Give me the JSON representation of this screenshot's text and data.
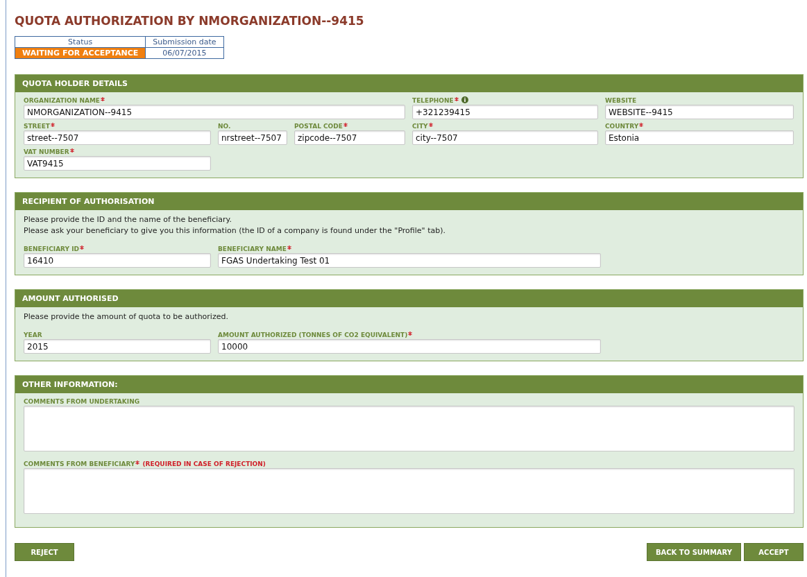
{
  "title": "QUOTA AUTHORIZATION BY NMORGANIZATION--9415",
  "status_table": {
    "columns": [
      "Status",
      "Submission date"
    ],
    "status": "WAITING FOR ACCEPTANCE",
    "submission_date": "06/07/2015"
  },
  "sections": [
    {
      "title": "QUOTA HOLDER DETAILS",
      "fields": [
        {
          "label": "ORGANIZATION NAME",
          "required": true,
          "info": false,
          "value": "NMORGANIZATION--9415"
        },
        {
          "label": "TELEPHONE",
          "required": true,
          "info": true,
          "value": "+321239415"
        },
        {
          "label": "WEBSITE",
          "required": false,
          "info": false,
          "value": "WEBSITE--9415"
        },
        {
          "label": "STREET",
          "required": true,
          "info": false,
          "value": "street--7507"
        },
        {
          "label": "NO.",
          "required": false,
          "info": false,
          "value": "nrstreet--7507"
        },
        {
          "label": "POSTAL CODE",
          "required": true,
          "info": false,
          "value": "zipcode--7507"
        },
        {
          "label": "CITY",
          "required": true,
          "info": false,
          "value": "city--7507"
        },
        {
          "label": "COUNTRY",
          "required": true,
          "info": false,
          "value": "Estonia"
        },
        {
          "label": "VAT NUMBER",
          "required": true,
          "info": false,
          "value": "VAT9415"
        }
      ]
    },
    {
      "title": "RECIPIENT OF AUTHORISATION",
      "intro": [
        "Please provide the ID and the name of the beneficiary.",
        "Please ask your beneficiary to give you this information (the ID of a company is found under the \"Profile\" tab)."
      ],
      "fields": [
        {
          "label": "BENEFICIARY ID",
          "required": true,
          "info": false,
          "value": "16410"
        },
        {
          "label": "BENEFICIARY NAME",
          "required": true,
          "info": false,
          "value": "FGAS Undertaking Test 01"
        }
      ]
    },
    {
      "title": "AMOUNT AUTHORISED",
      "intro": [
        "Please provide the amount of quota to be authorized."
      ],
      "fields": [
        {
          "label": "YEAR",
          "required": false,
          "info": false,
          "value": "2015"
        },
        {
          "label": "AMOUNT AUTHORIZED (TONNES OF CO2 EQUIVALENT)",
          "required": true,
          "info": false,
          "value": "10000"
        }
      ]
    },
    {
      "title": "OTHER INFORMATION:",
      "comments": [
        {
          "label": "COMMENTS FROM UNDERTAKING",
          "required": false
        },
        {
          "label": "COMMENTS FROM BENEFICIARY",
          "required": true,
          "note": "(REQUIRED IN CASE OF REJECTION)"
        }
      ]
    }
  ],
  "buttons_left": [
    "REJECT"
  ],
  "buttons_right": [
    "BACK TO SUMMARY",
    "ACCEPT"
  ]
}
